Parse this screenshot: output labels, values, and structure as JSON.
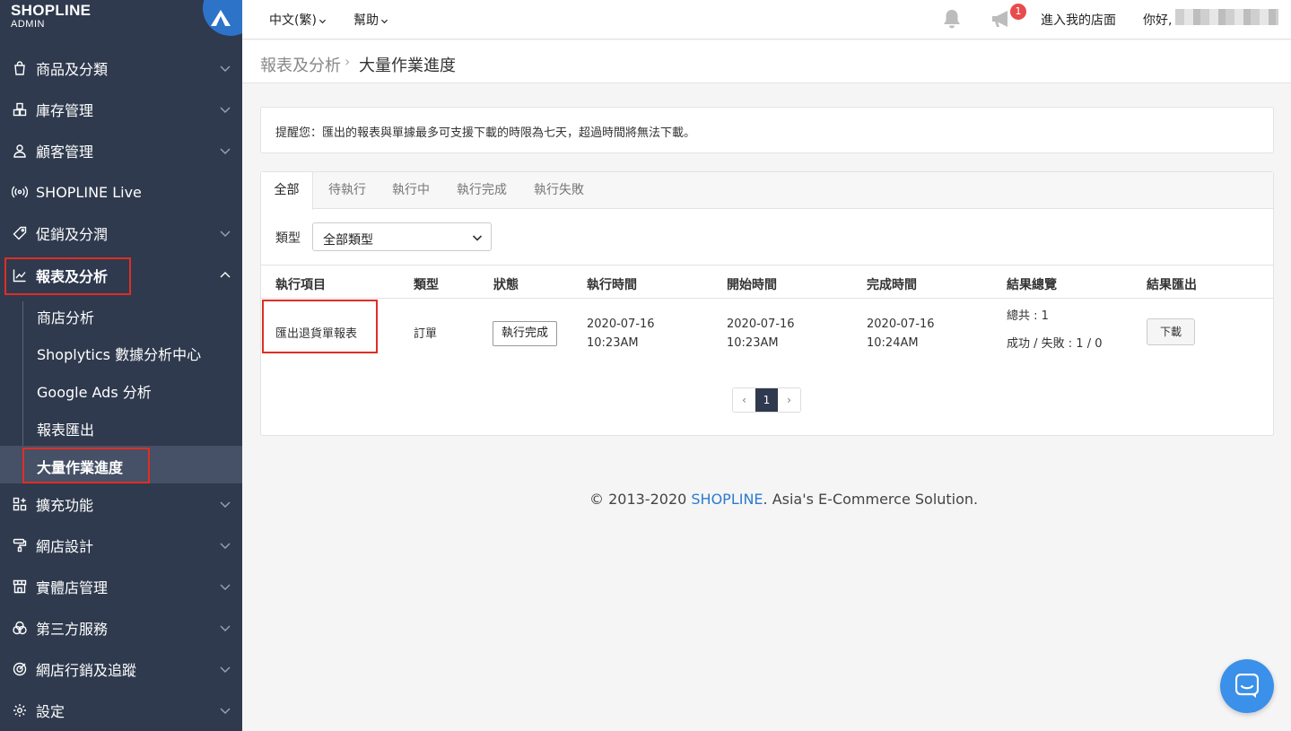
{
  "logo": {
    "brand": "SHOPLINE",
    "sub": "ADMIN"
  },
  "sidebar": {
    "items": [
      {
        "label": "商品及分類",
        "icon": "bag-icon"
      },
      {
        "label": "庫存管理",
        "icon": "boxes-icon"
      },
      {
        "label": "顧客管理",
        "icon": "person-icon"
      },
      {
        "label": "SHOPLINE Live",
        "icon": "broadcast-icon"
      },
      {
        "label": "促銷及分潤",
        "icon": "tag-icon"
      },
      {
        "label": "報表及分析",
        "icon": "chart-icon"
      },
      {
        "label": "擴充功能",
        "icon": "apps-icon"
      },
      {
        "label": "網店設計",
        "icon": "paint-roller-icon"
      },
      {
        "label": "實體店管理",
        "icon": "store-icon"
      },
      {
        "label": "第三方服務",
        "icon": "cube-icon"
      },
      {
        "label": "網店行銷及追蹤",
        "icon": "target-icon"
      },
      {
        "label": "設定",
        "icon": "gear-icon"
      }
    ],
    "sub_items": [
      {
        "label": "商店分析"
      },
      {
        "label": "Shoplytics 數據分析中心"
      },
      {
        "label": "Google Ads 分析"
      },
      {
        "label": "報表匯出"
      },
      {
        "label": "大量作業進度"
      }
    ]
  },
  "topbar": {
    "language": "中文(繁)",
    "help": "幫助",
    "notification_count": "1",
    "store_link": "進入我的店面",
    "greeting": "你好,"
  },
  "breadcrumb": {
    "parent": "報表及分析",
    "separator": "›",
    "current": "大量作業進度"
  },
  "notice": "提醒您：匯出的報表與單據最多可支援下載的時限為七天，超過時間將無法下載。",
  "tabs": [
    {
      "label": "全部"
    },
    {
      "label": "待執行"
    },
    {
      "label": "執行中"
    },
    {
      "label": "執行完成"
    },
    {
      "label": "執行失敗"
    }
  ],
  "filter": {
    "label": "類型",
    "selected": "全部類型"
  },
  "table": {
    "headers": [
      "執行項目",
      "類型",
      "狀態",
      "執行時間",
      "開始時間",
      "完成時間",
      "結果總覽",
      "結果匯出"
    ],
    "rows": [
      {
        "item": "匯出退貨單報表",
        "type": "訂單",
        "status": "執行完成",
        "exec_date": "2020-07-16",
        "exec_time": "10:23AM",
        "start_date": "2020-07-16",
        "start_time": "10:23AM",
        "end_date": "2020-07-16",
        "end_time": "10:24AM",
        "total": "總共 : 1",
        "result": "成功 / 失敗 : 1 / 0",
        "download": "下載"
      }
    ]
  },
  "pagination": {
    "prev": "‹",
    "current": "1",
    "next": "›"
  },
  "footer": {
    "prefix": "© 2013-2020 ",
    "brand": "SHOPLINE",
    "suffix": ". Asia's E-Commerce Solution."
  },
  "colors": {
    "sidebar": "#2f3a4e",
    "accent": "#2b7bd0",
    "highlight": "#e02e24",
    "badge": "#e74c4c",
    "chat": "#3b90e9"
  }
}
